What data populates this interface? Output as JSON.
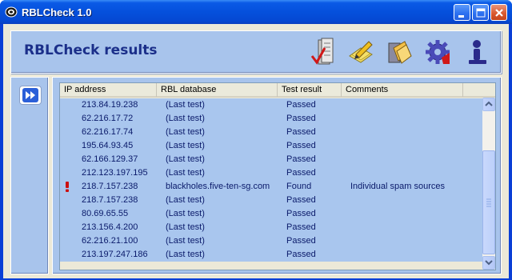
{
  "window": {
    "title": "RBLCheck 1.0"
  },
  "header": {
    "title": "RBLCheck results",
    "toolbar_icons": [
      "checklist-icon",
      "edit-pencil-icon",
      "folders-icon",
      "gear-icon",
      "user-info-icon"
    ]
  },
  "list": {
    "columns": [
      "IP address",
      "RBL database",
      "Test result",
      "Comments"
    ],
    "rows": [
      {
        "ip": "213.84.19.238",
        "db": "(Last test)",
        "result": "Passed",
        "comment": "",
        "flag": false
      },
      {
        "ip": "62.216.17.72",
        "db": "(Last test)",
        "result": "Passed",
        "comment": "",
        "flag": false
      },
      {
        "ip": "62.216.17.74",
        "db": "(Last test)",
        "result": "Passed",
        "comment": "",
        "flag": false
      },
      {
        "ip": "195.64.93.45",
        "db": "(Last test)",
        "result": "Passed",
        "comment": "",
        "flag": false
      },
      {
        "ip": "62.166.129.37",
        "db": "(Last test)",
        "result": "Passed",
        "comment": "",
        "flag": false
      },
      {
        "ip": "212.123.197.195",
        "db": "(Last test)",
        "result": "Passed",
        "comment": "",
        "flag": false
      },
      {
        "ip": "218.7.157.238",
        "db": "blackholes.five-ten-sg.com",
        "result": "Found",
        "comment": "Individual spam sources",
        "flag": true
      },
      {
        "ip": "218.7.157.238",
        "db": "(Last test)",
        "result": "Passed",
        "comment": "",
        "flag": false
      },
      {
        "ip": "80.69.65.55",
        "db": "(Last test)",
        "result": "Passed",
        "comment": "",
        "flag": false
      },
      {
        "ip": "213.156.4.200",
        "db": "(Last test)",
        "result": "Passed",
        "comment": "",
        "flag": false
      },
      {
        "ip": "62.216.21.100",
        "db": "(Last test)",
        "result": "Passed",
        "comment": "",
        "flag": false
      },
      {
        "ip": "213.197.247.186",
        "db": "(Last test)",
        "result": "Passed",
        "comment": "",
        "flag": false
      }
    ]
  },
  "colors": {
    "titlebar": "#0550dc",
    "panel": "#a8c4ec",
    "row_bg": "#a9c6ee",
    "row_text": "#0a1a6a",
    "header_title": "#1b2f8a",
    "flag_icon": "#cc1010"
  }
}
